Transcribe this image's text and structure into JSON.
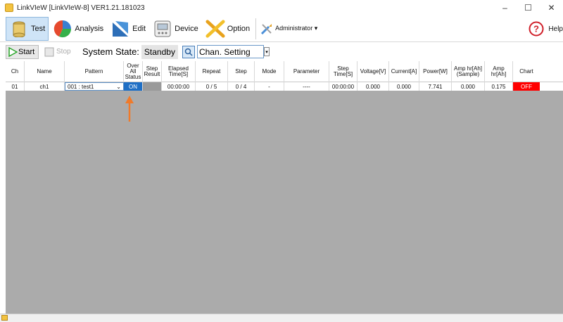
{
  "window": {
    "title": "LinkVIeW [LinkVIeW-8] VER1.21.181023",
    "minimize": "–",
    "maximize": "☐",
    "close": "✕"
  },
  "toolbar": {
    "items": [
      {
        "label": "Test",
        "icon": "test-icon"
      },
      {
        "label": "Analysis",
        "icon": "analysis-icon"
      },
      {
        "label": "Edit",
        "icon": "edit-icon"
      },
      {
        "label": "Device",
        "icon": "device-icon"
      },
      {
        "label": "Option",
        "icon": "option-icon"
      }
    ],
    "admin_label": "Administrator ▾",
    "help_label": "Help"
  },
  "subbar": {
    "start_label": "Start",
    "stop_label": "Stop",
    "state_label": "System State:",
    "state_value": "Standby",
    "channel_select": "Chan. Setting"
  },
  "grid": {
    "headers": [
      "Ch",
      "Name",
      "Pattern",
      "Over\nAll\nStatus",
      "Step\nResult",
      "Elapsed\nTime[S]",
      "Repeat",
      "Step",
      "Mode",
      "Parameter",
      "Step\nTime[S]",
      "Voltage[V]",
      "Current[A]",
      "Power[W]",
      "Amp hr[Ah]\n(Sample)",
      "Amp hr[Ah]",
      "Chart"
    ],
    "row": {
      "ch": "01",
      "name": "ch1",
      "pattern": "001 : test1",
      "status": "ON",
      "step_result": "",
      "elapsed": "00:00:00",
      "repeat": "0 / 5",
      "step": "0 / 4",
      "mode": "-",
      "parameter": "----",
      "step_time": "00:00:00",
      "voltage": "0.000",
      "current": "0.000",
      "power": "7.741",
      "amp_sample": "0.000",
      "amp": "0.175",
      "chart": "OFF"
    }
  },
  "colors": {
    "accent": "#1f6fc5",
    "off": "#ff0000",
    "grid_bg": "#ababab",
    "arrow": "#f07a2a"
  }
}
